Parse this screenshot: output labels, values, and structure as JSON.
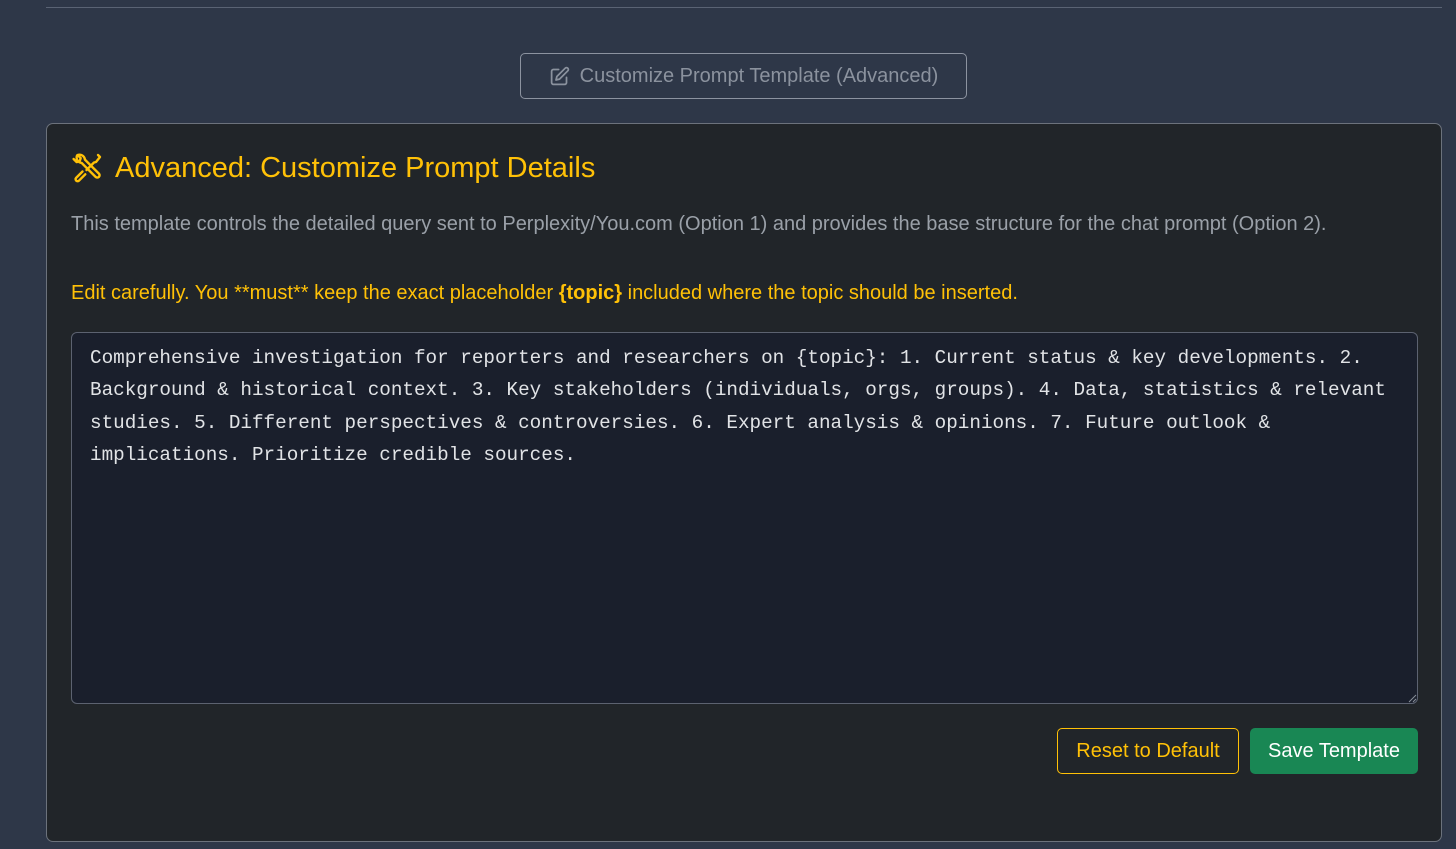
{
  "customize_button": {
    "label": "Customize Prompt Template (Advanced)",
    "icon": "pencil-square-icon"
  },
  "panel": {
    "title": "Advanced: Customize Prompt Details",
    "title_icon": "tools-icon",
    "description": "This template controls the detailed query sent to Perplexity/You.com (Option 1) and provides the base structure for the chat prompt (Option 2).",
    "warning_before": "Edit carefully. You **must** keep the exact placeholder ",
    "warning_placeholder": "{topic}",
    "warning_after": " included where the topic should be inserted.",
    "template_value": "Comprehensive investigation for reporters and researchers on {topic}: 1. Current status & key developments. 2. Background & historical context. 3. Key stakeholders (individuals, orgs, groups). 4. Data, statistics & relevant studies. 5. Different perspectives & controversies. 6. Expert analysis & opinions. 7. Future outlook & implications. Prioritize credible sources.",
    "reset_label": "Reset to Default",
    "save_label": "Save Template"
  },
  "colors": {
    "page_bg": "#2e3748",
    "panel_bg": "#212529",
    "accent_warning": "#ffc107",
    "success": "#198754"
  }
}
